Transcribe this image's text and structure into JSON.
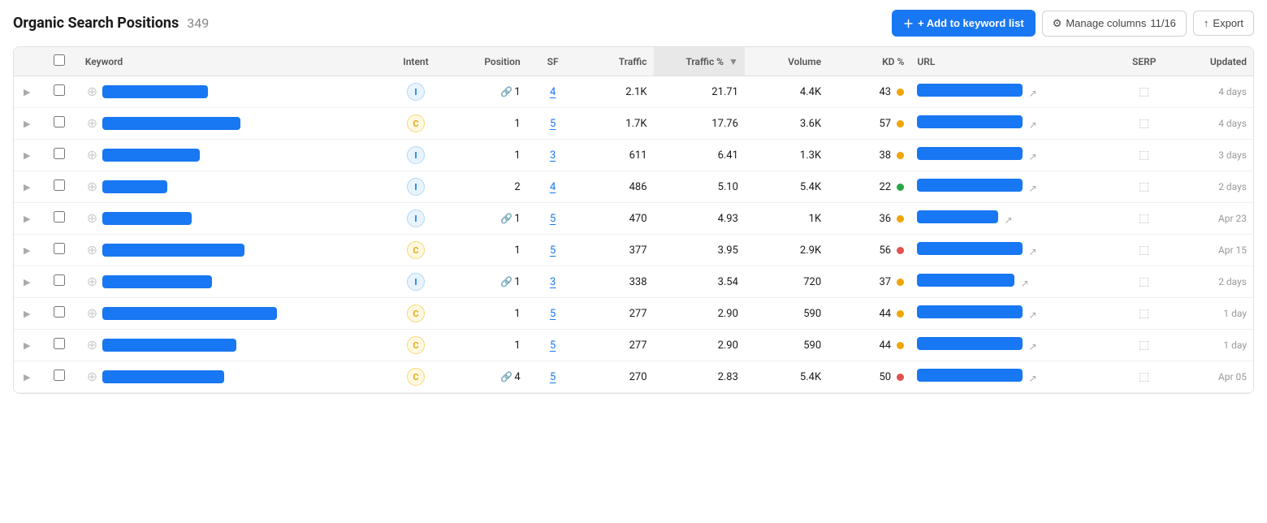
{
  "header": {
    "title": "Organic Search Positions",
    "count": "349",
    "add_keyword_label": "+ Add to keyword list",
    "manage_columns_label": "Manage columns",
    "manage_columns_count": "11/16",
    "export_label": "Export"
  },
  "table": {
    "columns": [
      {
        "id": "keyword",
        "label": "Keyword"
      },
      {
        "id": "intent",
        "label": "Intent"
      },
      {
        "id": "position",
        "label": "Position"
      },
      {
        "id": "sf",
        "label": "SF"
      },
      {
        "id": "traffic",
        "label": "Traffic"
      },
      {
        "id": "trafficpct",
        "label": "Traffic %",
        "sorted": true
      },
      {
        "id": "volume",
        "label": "Volume"
      },
      {
        "id": "kd",
        "label": "KD %"
      },
      {
        "id": "url",
        "label": "URL"
      },
      {
        "id": "serp",
        "label": "SERP"
      },
      {
        "id": "updated",
        "label": "Updated"
      }
    ],
    "rows": [
      {
        "keyword_width": 130,
        "intent": "I",
        "intent_type": "i",
        "has_link": true,
        "position": "1",
        "sf": "4",
        "traffic": "2.1K",
        "traffic_pct": "21.71",
        "volume": "4.4K",
        "kd": "43",
        "kd_color": "orange",
        "url_width": 130,
        "updated": "4 days"
      },
      {
        "keyword_width": 170,
        "intent": "C",
        "intent_type": "c",
        "has_link": false,
        "position": "1",
        "sf": "5",
        "traffic": "1.7K",
        "traffic_pct": "17.76",
        "volume": "3.6K",
        "kd": "57",
        "kd_color": "orange",
        "url_width": 130,
        "updated": "4 days"
      },
      {
        "keyword_width": 120,
        "intent": "I",
        "intent_type": "i",
        "has_link": false,
        "position": "1",
        "sf": "3",
        "traffic": "611",
        "traffic_pct": "6.41",
        "volume": "1.3K",
        "kd": "38",
        "kd_color": "orange",
        "url_width": 130,
        "updated": "3 days"
      },
      {
        "keyword_width": 80,
        "intent": "I",
        "intent_type": "i",
        "has_link": false,
        "position": "2",
        "sf": "4",
        "traffic": "486",
        "traffic_pct": "5.10",
        "volume": "5.4K",
        "kd": "22",
        "kd_color": "green",
        "url_width": 130,
        "updated": "2 days"
      },
      {
        "keyword_width": 110,
        "intent": "I",
        "intent_type": "i",
        "has_link": true,
        "position": "1",
        "sf": "5",
        "traffic": "470",
        "traffic_pct": "4.93",
        "volume": "1K",
        "kd": "36",
        "kd_color": "orange",
        "url_width": 100,
        "updated": "Apr 23"
      },
      {
        "keyword_width": 175,
        "intent": "C",
        "intent_type": "c",
        "has_link": false,
        "position": "1",
        "sf": "5",
        "traffic": "377",
        "traffic_pct": "3.95",
        "volume": "2.9K",
        "kd": "56",
        "kd_color": "red",
        "url_width": 130,
        "updated": "Apr 15"
      },
      {
        "keyword_width": 135,
        "intent": "I",
        "intent_type": "i",
        "has_link": true,
        "position": "1",
        "sf": "3",
        "traffic": "338",
        "traffic_pct": "3.54",
        "volume": "720",
        "kd": "37",
        "kd_color": "orange",
        "url_width": 120,
        "updated": "2 days"
      },
      {
        "keyword_width": 215,
        "intent": "C",
        "intent_type": "c",
        "has_link": false,
        "position": "1",
        "sf": "5",
        "traffic": "277",
        "traffic_pct": "2.90",
        "volume": "590",
        "kd": "44",
        "kd_color": "orange",
        "url_width": 130,
        "updated": "1 day"
      },
      {
        "keyword_width": 165,
        "intent": "C",
        "intent_type": "c",
        "has_link": false,
        "position": "1",
        "sf": "5",
        "traffic": "277",
        "traffic_pct": "2.90",
        "volume": "590",
        "kd": "44",
        "kd_color": "orange",
        "url_width": 130,
        "updated": "1 day"
      },
      {
        "keyword_width": 150,
        "intent": "C",
        "intent_type": "c",
        "has_link": true,
        "position": "4",
        "sf": "5",
        "traffic": "270",
        "traffic_pct": "2.83",
        "volume": "5.4K",
        "kd": "50",
        "kd_color": "red",
        "url_width": 130,
        "updated": "Apr 05"
      }
    ]
  }
}
